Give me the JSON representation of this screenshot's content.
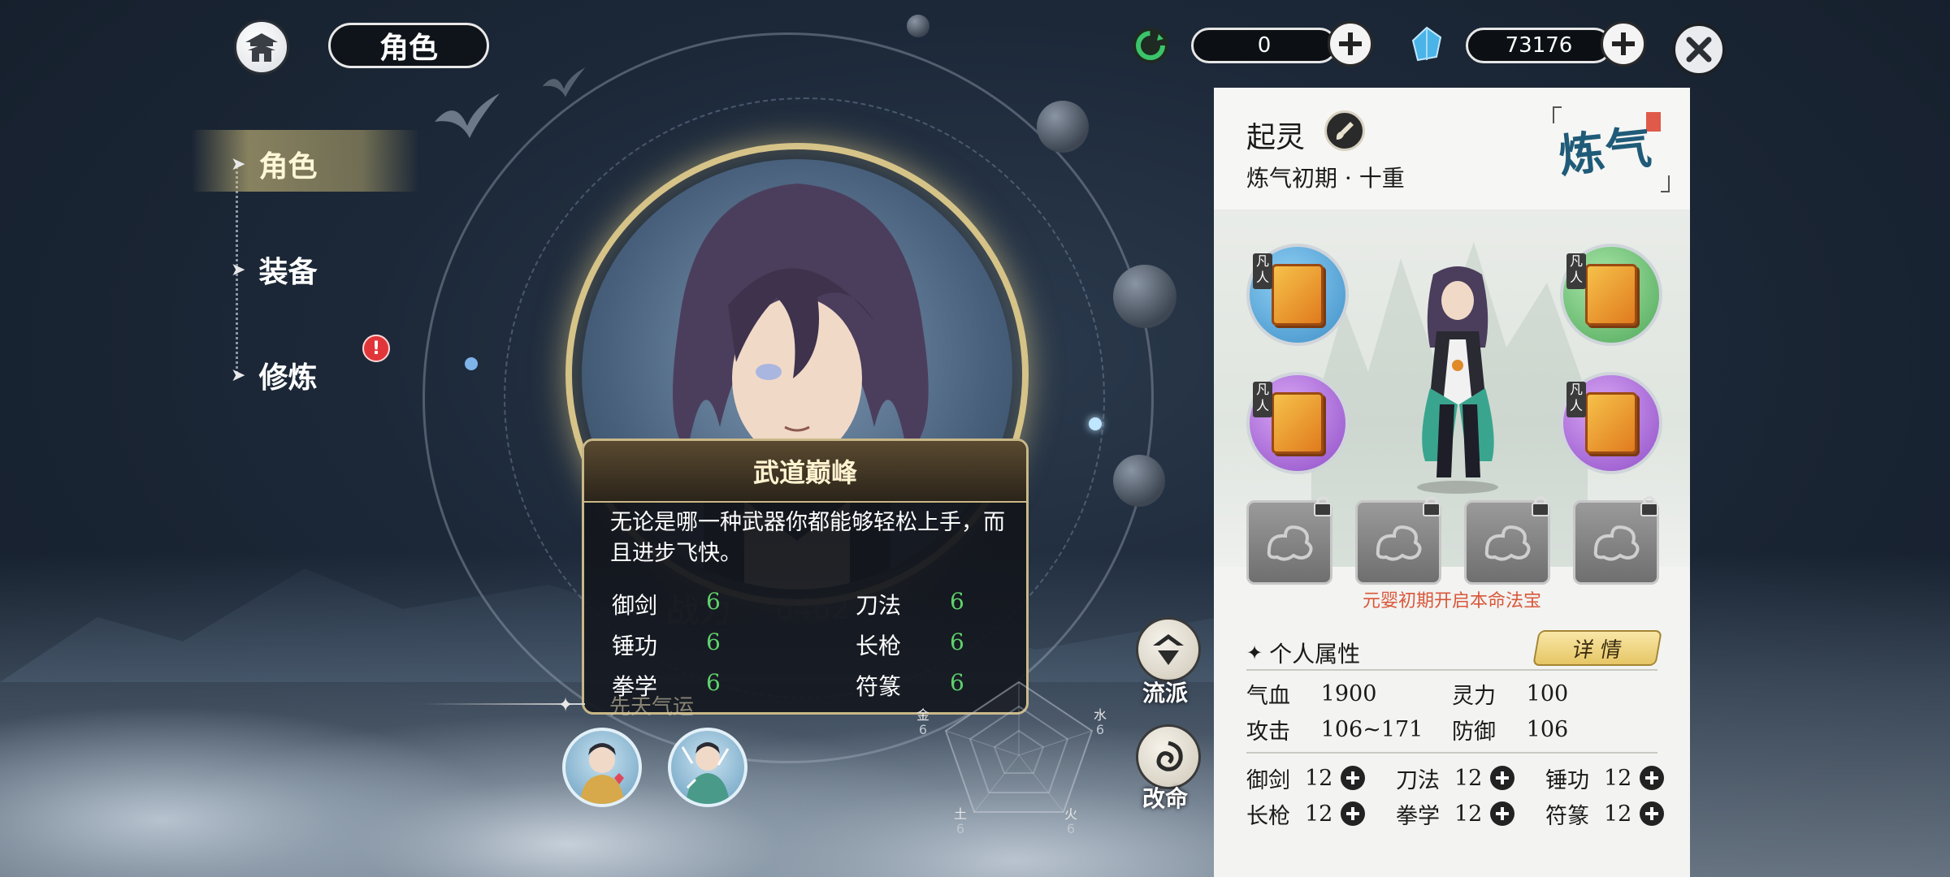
{
  "header": {
    "title": "角色",
    "resource1_value": "0",
    "resource2_value": "73176"
  },
  "nav": {
    "items": [
      {
        "label": "角色",
        "active": true
      },
      {
        "label": "装备",
        "active": false
      },
      {
        "label": "修炼",
        "active": false,
        "alert": true
      }
    ],
    "alert_glyph": "!"
  },
  "trait_tooltip": {
    "title": "武道巅峰",
    "description": "无论是哪一种武器你都能够轻松上手，而且进步飞快。",
    "stats": [
      {
        "label": "御剑",
        "value": "6"
      },
      {
        "label": "刀法",
        "value": "6"
      },
      {
        "label": "锤功",
        "value": "6"
      },
      {
        "label": "长枪",
        "value": "6"
      },
      {
        "label": "拳学",
        "value": "6"
      },
      {
        "label": "符篆",
        "value": "6"
      }
    ]
  },
  "combat_power": {
    "label": "战力",
    "value": "6462"
  },
  "innate_fortune_label": "先天气运",
  "radar": {
    "elements": [
      {
        "label": "金",
        "value": "6"
      },
      {
        "label": "水",
        "value": "6"
      },
      {
        "label": "土",
        "value": "6"
      },
      {
        "label": "火",
        "value": "6"
      }
    ]
  },
  "side_buttons": {
    "sect": "流派",
    "fate": "改命"
  },
  "character_panel": {
    "name": "起灵",
    "realm": "炼气初期 · 十重",
    "realm_stamp": "炼气",
    "skill_tag": "凡人",
    "locked_note": "元婴初期开启本命法宝",
    "attributes_header": "个人属性",
    "detail_button": "详 情",
    "attributes": [
      {
        "label": "气血",
        "value": "1900"
      },
      {
        "label": "灵力",
        "value": "100"
      },
      {
        "label": "攻击",
        "value": "106~171"
      },
      {
        "label": "防御",
        "value": "106"
      }
    ],
    "skills": [
      {
        "label": "御剑",
        "value": "12"
      },
      {
        "label": "刀法",
        "value": "12"
      },
      {
        "label": "锤功",
        "value": "12"
      },
      {
        "label": "长枪",
        "value": "12"
      },
      {
        "label": "拳学",
        "value": "12"
      },
      {
        "label": "符篆",
        "value": "12"
      }
    ]
  },
  "colors": {
    "accent_gold": "#d6c388",
    "stat_green": "#5fd16b",
    "note_red": "#d9573a",
    "alert_red": "#e0363a"
  }
}
